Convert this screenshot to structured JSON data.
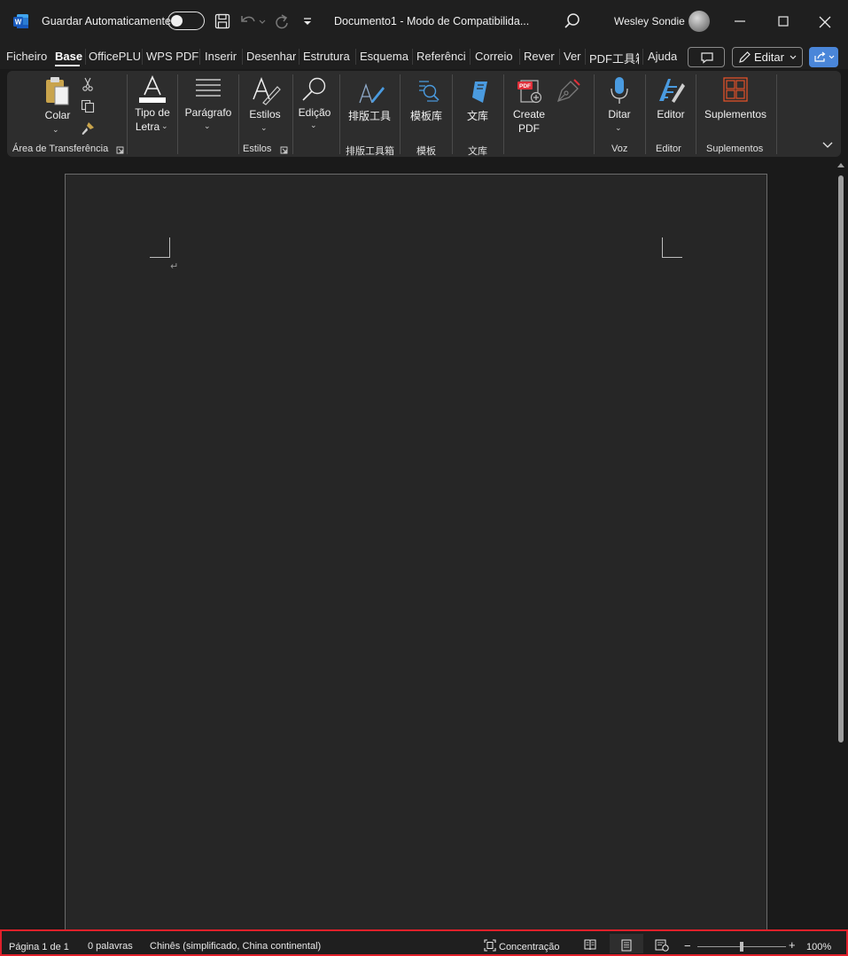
{
  "titlebar": {
    "autosave_label": "Guardar Automaticamente",
    "autosave_on": false,
    "doc_title": "Documento1  -  Modo de Compatibilida...",
    "user_name": "Wesley Sondie",
    "app_icon_letter": "W"
  },
  "tabs": [
    "Ficheiro",
    "Base",
    "OfficePLU",
    "WPS PDF",
    "Inserir",
    "Desenhar",
    "Estrutura",
    "Esquema",
    "Referênci",
    "Correio",
    "Rever",
    "Ver",
    "PDF工具箱",
    "Ajuda"
  ],
  "active_tab": "Base",
  "tab_actions": {
    "edit_label": "Editar"
  },
  "ribbon": {
    "paste": "Colar",
    "font": "Tipo de",
    "font2": "Letra",
    "paragraph": "Parágrafo",
    "styles": "Estilos",
    "editing": "Edição",
    "layout_tools": "排版工具",
    "templates": "模板库",
    "library": "文库",
    "create_pdf": "Create",
    "create_pdf2": "PDF",
    "dictate": "Ditar",
    "editor": "Editor",
    "addins": "Suplementos",
    "groups": {
      "clipboard": "Área de Transferência",
      "styles": "Estilos",
      "layout_box": "排版工具箱",
      "template": "模板",
      "library": "文库",
      "voice": "Voz",
      "editor": "Editor",
      "addins": "Suplementos"
    }
  },
  "status": {
    "page": "Página 1 de 1",
    "words": "0 palavras",
    "language": "Chinês (simplificado, China continental)",
    "focus": "Concentração",
    "zoom": "100%",
    "zoom_minus": "−",
    "zoom_plus": "+"
  },
  "colors": {
    "accent": "#4a86d9",
    "highlight_border": "#e0202a",
    "word_blue": "#185abd"
  }
}
